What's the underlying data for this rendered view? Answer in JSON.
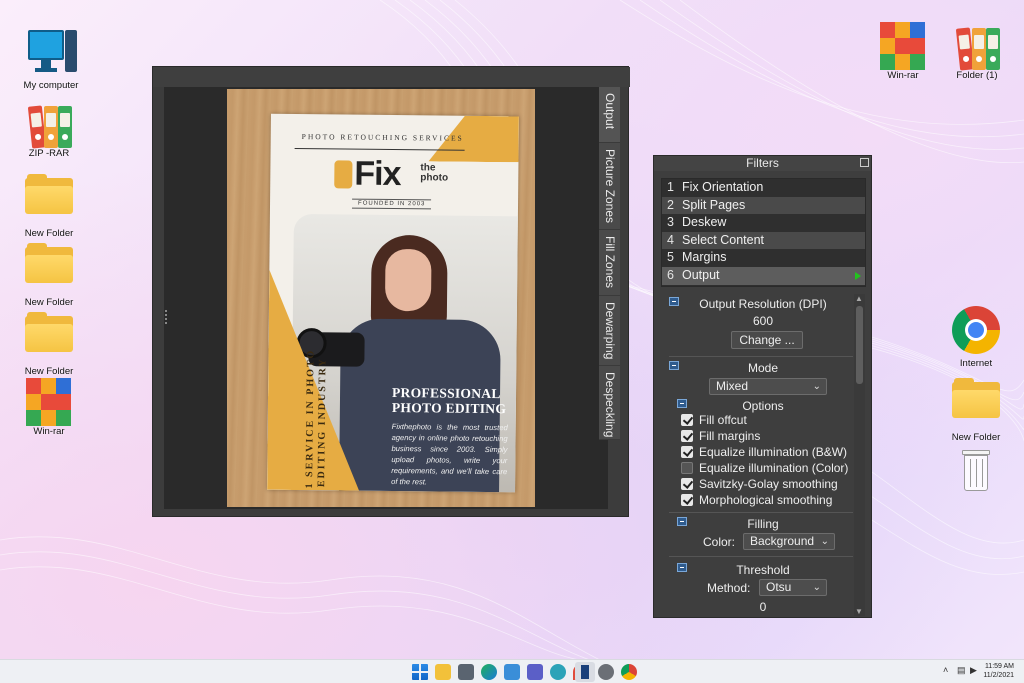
{
  "desktop": {
    "left_icons": [
      {
        "label": "My computer",
        "icon": "monitor-icon"
      },
      {
        "label": "ZIP -RAR",
        "icon": "binders-icon"
      },
      {
        "label": "New Folder",
        "icon": "folder-icon"
      },
      {
        "label": "New Folder",
        "icon": "folder-icon"
      },
      {
        "label": "New Folder",
        "icon": "folder-icon"
      },
      {
        "label": "Win-rar",
        "icon": "winrar-icon"
      }
    ],
    "right_icons": [
      {
        "label": "Win-rar",
        "icon": "winrar-icon"
      },
      {
        "label": "Folder (1)",
        "icon": "binders-icon"
      },
      {
        "label": "Internet",
        "icon": "chrome-icon"
      },
      {
        "label": "New Folder",
        "icon": "folder-icon"
      },
      {
        "label": "",
        "icon": "recycle-bin-icon"
      }
    ]
  },
  "scantailor": {
    "tabs": [
      "Output",
      "Picture Zones",
      "Fill Zones",
      "Dewarping",
      "Despeckling"
    ],
    "document": {
      "top_line": "PHOTO RETOUCHING SERVICES",
      "logo": "Fix",
      "logo_sub1": "the",
      "logo_sub2": "photo",
      "founded": "FOUNDED IN 2003",
      "headline1": "PROFESSIONAL",
      "headline2": "PHOTO EDITING",
      "body": "Fixthephoto is the most trusted agency in online photo retouching business since 2003. Simply upload photos, write your requirements, and we'll take care of the rest.",
      "vertical": "#1 SERVICE IN PHOTO EDITING INDUSTRY"
    }
  },
  "filters": {
    "title": "Filters",
    "items": [
      {
        "num": "1",
        "label": "Fix Orientation"
      },
      {
        "num": "2",
        "label": "Split Pages"
      },
      {
        "num": "3",
        "label": "Deskew"
      },
      {
        "num": "4",
        "label": "Select Content"
      },
      {
        "num": "5",
        "label": "Margins"
      },
      {
        "num": "6",
        "label": "Output"
      }
    ],
    "active_index": 5,
    "output_resolution": {
      "title": "Output Resolution (DPI)",
      "value": "600",
      "change_label": "Change ..."
    },
    "mode": {
      "title": "Mode",
      "value": "Mixed"
    },
    "options": {
      "title": "Options",
      "checks": [
        {
          "label": "Fill offcut",
          "checked": true
        },
        {
          "label": "Fill margins",
          "checked": true
        },
        {
          "label": "Equalize illumination (B&W)",
          "checked": true
        },
        {
          "label": "Equalize illumination (Color)",
          "checked": false
        },
        {
          "label": "Savitzky-Golay smoothing",
          "checked": true
        },
        {
          "label": "Morphological smoothing",
          "checked": true
        }
      ]
    },
    "filling": {
      "title": "Filling",
      "color_label": "Color:",
      "color_value": "Background"
    },
    "threshold": {
      "title": "Threshold",
      "method_label": "Method:",
      "method_value": "Otsu",
      "value": "0"
    }
  },
  "taskbar": {
    "icons": [
      "windows-start-icon",
      "file-explorer-icon",
      "camera-icon",
      "edge-icon",
      "store-icon",
      "teams-icon",
      "photos-icon",
      "maps-icon",
      "scantailor-icon",
      "settings-icon",
      "chrome-icon"
    ],
    "clock_time": "11:59 AM",
    "clock_date": "11/2/2021"
  },
  "colors": {
    "accent_green": "#22c21e",
    "panel_bg": "#3e3e3e",
    "flyer_yellow": "#e6ac43"
  }
}
